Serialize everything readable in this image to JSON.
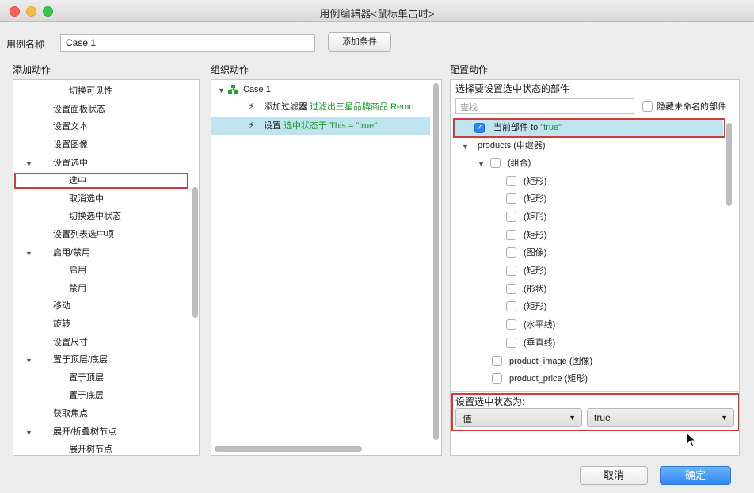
{
  "window": {
    "title": "用例编辑器<鼠标单击时>"
  },
  "header": {
    "name_label": "用例名称",
    "name_value": "Case 1",
    "add_condition_label": "添加条件"
  },
  "sections": {
    "add_action": "添加动作",
    "organize_action": "组织动作",
    "configure_action": "配置动作"
  },
  "add_actions": [
    "切换可见性",
    "设置面板状态",
    "设置文本",
    "设置图像",
    "设置选中",
    "选中",
    "取消选中",
    "切换选中状态",
    "设置列表选中项",
    "启用/禁用",
    "启用",
    "禁用",
    "移动",
    "旋转",
    "设置尺寸",
    "置于顶层/底层",
    "置于顶层",
    "置于底层",
    "获取焦点",
    "展开/折叠树节点",
    "展开树节点"
  ],
  "organize": {
    "case_name": "Case 1",
    "action1_prefix": "添加过滤器",
    "action1_value": "过滤出三星品牌商品 Remo",
    "action2_prefix": "设置",
    "action2_value": "选中状态于 This = \"true\""
  },
  "configure": {
    "heading": "选择要设置选中状态的部件",
    "search_placeholder": "查找",
    "hide_unnamed_label": "隐藏未命名的部件",
    "current_widget_label": "当前部件 to",
    "current_widget_value": "\"true\"",
    "tree": [
      "products (中继器)",
      "(组合)",
      "(矩形)",
      "(矩形)",
      "(矩形)",
      "(矩形)",
      "(图像)",
      "(矩形)",
      "(形状)",
      "(矩形)",
      "(水平线)",
      "(垂直线)",
      "product_image (图像)",
      "product_price (矩形)"
    ],
    "set_state_label": "设置选中状态为:",
    "value_type": "值",
    "value": "true"
  },
  "footer": {
    "cancel_label": "取消",
    "ok_label": "确定"
  },
  "colors": {
    "selected_row": "#bfe4f0",
    "accent_green": "#1c9a2b",
    "highlight_red": "#d13b3b",
    "primary_blue": "#2f86f4"
  }
}
